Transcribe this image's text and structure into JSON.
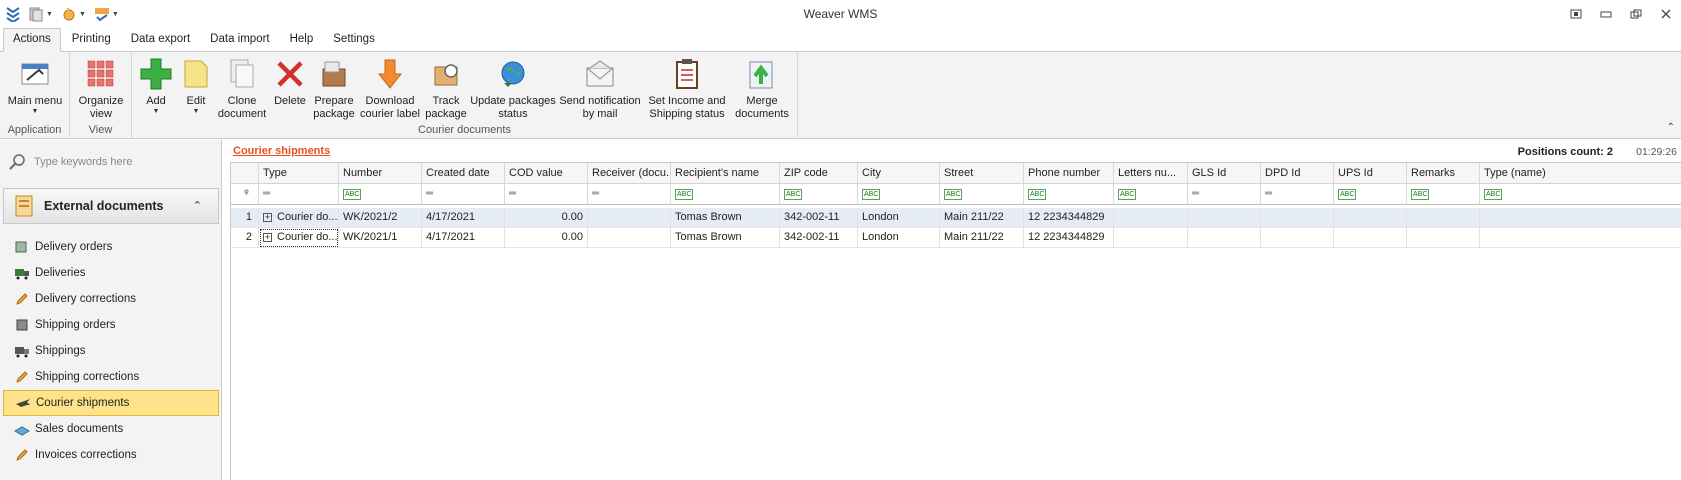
{
  "window": {
    "title": "Weaver WMS"
  },
  "tabs": [
    "Actions",
    "Printing",
    "Data export",
    "Data import",
    "Help",
    "Settings"
  ],
  "ribbon": {
    "groups": {
      "application": "Application",
      "view": "View",
      "courier": "Courier documents"
    },
    "buttons": {
      "main_menu": "Main menu",
      "organize_view": "Organize\nview",
      "add": "Add",
      "edit": "Edit",
      "clone_document": "Clone\ndocument",
      "delete": "Delete",
      "prepare_package": "Prepare\npackage",
      "download_label": "Download\ncourier label",
      "track_package": "Track\npackage",
      "update_status": "Update packages\nstatus",
      "send_notification": "Send notification\nby mail",
      "set_income": "Set Income and\nShipping status",
      "merge_documents": "Merge\ndocuments"
    }
  },
  "sidebar": {
    "search_placeholder": "Type keywords here",
    "group_title": "External documents",
    "items": [
      {
        "label": "Delivery orders",
        "icon": "delivery-orders-icon"
      },
      {
        "label": "Deliveries",
        "icon": "truck-icon"
      },
      {
        "label": "Delivery corrections",
        "icon": "pencil-icon"
      },
      {
        "label": "Shipping orders",
        "icon": "shipping-orders-icon"
      },
      {
        "label": "Shippings",
        "icon": "truck-icon"
      },
      {
        "label": "Shipping corrections",
        "icon": "pencil-icon"
      },
      {
        "label": "Courier shipments",
        "icon": "airplane-icon",
        "selected": true
      },
      {
        "label": "Sales documents",
        "icon": "sales-icon"
      },
      {
        "label": "Invoices corrections",
        "icon": "pencil-icon"
      }
    ]
  },
  "grid": {
    "title": "Courier shipments",
    "positions_count": "Positions count: 2",
    "time": "01:29:26",
    "columns": [
      "Type",
      "Number",
      "Created date",
      "COD value",
      "Receiver (docu...",
      "Recipient's name",
      "ZIP code",
      "City",
      "Street",
      "Phone number",
      "Letters nu...",
      "GLS Id",
      "DPD Id",
      "UPS Id",
      "Remarks",
      "Type (name)"
    ],
    "rows": [
      {
        "idx": "1",
        "type": "Courier do...",
        "number": "WK/2021/2",
        "created": "4/17/2021",
        "cod": "0.00",
        "receiver": "",
        "recipient": "Tomas Brown",
        "zip": "342-002-11",
        "city": "London",
        "street": "Main 211/22",
        "phone": "12 2234344829",
        "letters": "",
        "gls": "",
        "dpd": "",
        "ups": "",
        "remarks": "",
        "typename": ""
      },
      {
        "idx": "2",
        "type": "Courier do...",
        "number": "WK/2021/1",
        "created": "4/17/2021",
        "cod": "0.00",
        "receiver": "",
        "recipient": "Tomas Brown",
        "zip": "342-002-11",
        "city": "London",
        "street": "Main 211/22",
        "phone": "12 2234344829",
        "letters": "",
        "gls": "",
        "dpd": "",
        "ups": "",
        "remarks": "",
        "typename": ""
      }
    ]
  },
  "colors": {
    "accent": "#e8501c",
    "selection": "#fde38a"
  }
}
